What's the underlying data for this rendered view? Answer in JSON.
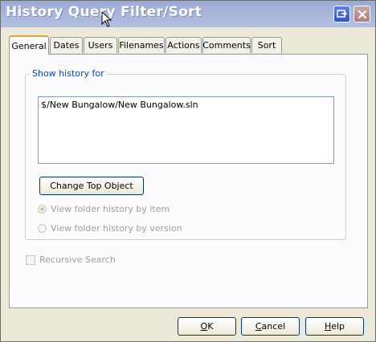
{
  "window": {
    "title": "History Query Filter/Sort"
  },
  "tabs": [
    {
      "label": "General",
      "active": true
    },
    {
      "label": "Dates"
    },
    {
      "label": "Users"
    },
    {
      "label": "Filenames"
    },
    {
      "label": "Actions"
    },
    {
      "label": "Comments"
    },
    {
      "label": "Sort"
    }
  ],
  "general": {
    "group_label": "Show history for",
    "history_items": [
      "$/New Bungalow/New Bungalow.sln"
    ],
    "change_top_object_label": "Change Top Object",
    "radio_by_item": {
      "label": "View folder history by item",
      "checked": true,
      "enabled": false
    },
    "radio_by_version": {
      "label": "View folder history by version",
      "checked": false,
      "enabled": false
    },
    "recursive_search": {
      "label": "Recursive Search",
      "checked": false,
      "enabled": false
    }
  },
  "buttons": {
    "ok": {
      "mnemonic": "O",
      "rest": "K"
    },
    "cancel": {
      "mnemonic": "C",
      "rest": "ancel"
    },
    "help": {
      "mnemonic": "H",
      "rest": "elp"
    }
  },
  "colors": {
    "accent_tab": "#e8a23c",
    "group_label": "#0046d5",
    "titlebar": "#a5b3da"
  }
}
